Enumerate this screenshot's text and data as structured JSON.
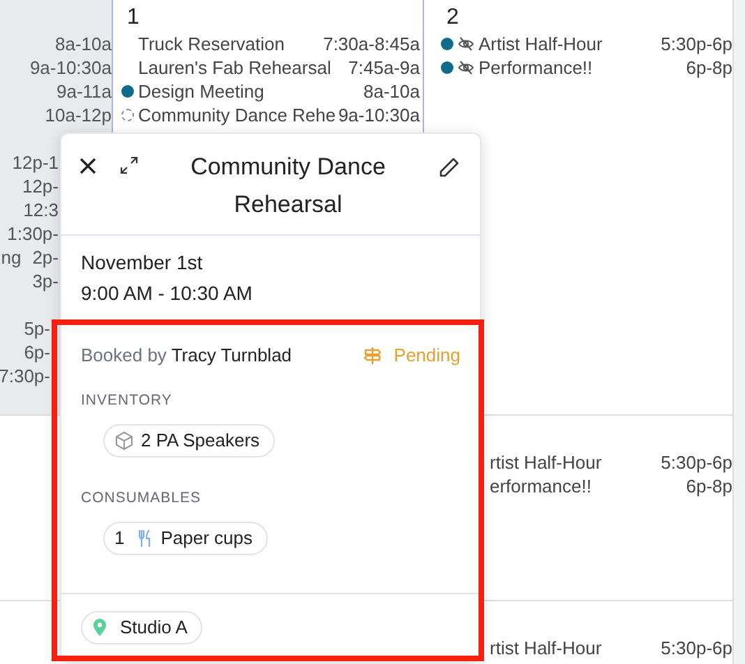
{
  "left_column": {
    "entries": [
      {
        "kind": "full",
        "time": "8a-10a"
      },
      {
        "kind": "full",
        "time": "9a-10:30a"
      },
      {
        "kind": "full",
        "time": "9a-11a"
      },
      {
        "kind": "full",
        "time": "10a-12p"
      },
      {
        "kind": "cut",
        "time": "12p-1",
        "gap_before": true
      },
      {
        "kind": "cut",
        "time": "12p-"
      },
      {
        "kind": "cut",
        "time": "12:3"
      },
      {
        "kind": "cut",
        "time": "1:30p-"
      },
      {
        "kind": "cut",
        "title": "ng",
        "time": "2p-"
      },
      {
        "kind": "cut",
        "time": "3p-"
      },
      {
        "kind": "framed",
        "time": "5p-",
        "gap_before": true
      },
      {
        "kind": "framed",
        "time": "6p-"
      },
      {
        "kind": "framed",
        "time": "7:30p-"
      }
    ]
  },
  "days": [
    {
      "number": "1",
      "events": [
        {
          "title": "Truck Reservation",
          "time": "7:30a-8:45a",
          "kind": "plain"
        },
        {
          "title": "Lauren's Fab Rehearsal",
          "time": "7:45a-9a",
          "kind": "plain"
        },
        {
          "title": "Design Meeting",
          "time": "8a-10a",
          "kind": "dot",
          "color": "#0e6b8a"
        },
        {
          "title": "Community Dance Rehe",
          "time": "9a-10:30a",
          "kind": "pending"
        }
      ]
    },
    {
      "number": "2",
      "events": [
        {
          "title": "Artist Half-Hour",
          "time": "5:30p-6p",
          "kind": "dot",
          "color": "#0e6b8a",
          "hidden": true
        },
        {
          "title": "Performance!!",
          "time": "6p-8p",
          "kind": "dot",
          "color": "#0e6b8a",
          "hidden": true
        }
      ]
    }
  ],
  "later_weeks": [
    {
      "events": [
        {
          "title": "rtist Half-Hour",
          "time": "5:30p-6p"
        },
        {
          "title": "erformance!!",
          "time": "6p-8p"
        }
      ]
    },
    {
      "events": [
        {
          "title": "rtist Half-Hour",
          "time": "5:30p-6p"
        }
      ]
    }
  ],
  "popup": {
    "title": "Community Dance Rehearsal",
    "date": "November 1st",
    "time": "9:00 AM - 10:30 AM",
    "booked_by_label": "Booked by",
    "booked_by": "Tracy Turnblad",
    "status": "Pending",
    "sections": [
      {
        "heading": "INVENTORY",
        "items": [
          {
            "kind": "inventory",
            "label": "2 PA Speakers"
          }
        ]
      },
      {
        "heading": "CONSUMABLES",
        "items": [
          {
            "kind": "consumable",
            "quantity": "1",
            "label": "Paper cups"
          }
        ]
      }
    ],
    "location": "Studio A"
  }
}
